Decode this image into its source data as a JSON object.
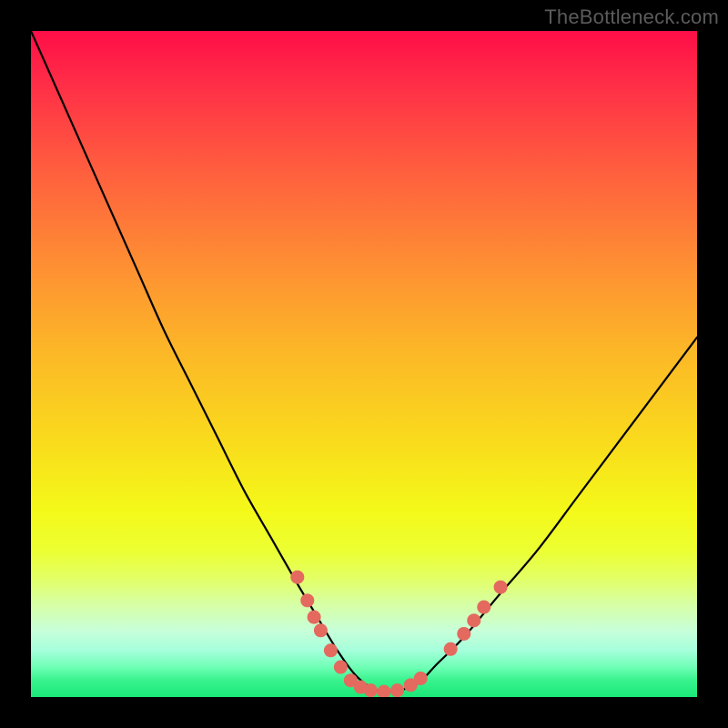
{
  "watermark": "TheBottleneck.com",
  "chart_data": {
    "type": "line",
    "title": "",
    "xlabel": "",
    "ylabel": "",
    "xlim": [
      0,
      100
    ],
    "ylim": [
      0,
      100
    ],
    "grid": false,
    "series": [
      {
        "name": "curve",
        "x": [
          0,
          4,
          8,
          12,
          16,
          20,
          24,
          28,
          32,
          36,
          40,
          43,
          46,
          49,
          52,
          55,
          58,
          61,
          65,
          70,
          76,
          82,
          88,
          94,
          100
        ],
        "y": [
          100,
          91,
          82,
          73,
          64,
          55,
          47,
          39,
          31,
          24,
          17,
          12,
          7,
          3,
          1,
          1,
          2,
          5,
          9,
          15,
          22,
          30,
          38,
          46,
          54
        ]
      }
    ],
    "markers": {
      "name": "highlight-dots",
      "color": "#e4695e",
      "points": [
        {
          "x": 40.0,
          "y": 18.0
        },
        {
          "x": 41.5,
          "y": 14.5
        },
        {
          "x": 42.5,
          "y": 12.0
        },
        {
          "x": 43.5,
          "y": 10.0
        },
        {
          "x": 45.0,
          "y": 7.0
        },
        {
          "x": 46.5,
          "y": 4.5
        },
        {
          "x": 48.0,
          "y": 2.5
        },
        {
          "x": 49.5,
          "y": 1.5
        },
        {
          "x": 51.0,
          "y": 1.0
        },
        {
          "x": 53.0,
          "y": 0.8
        },
        {
          "x": 55.0,
          "y": 1.0
        },
        {
          "x": 57.0,
          "y": 1.8
        },
        {
          "x": 58.5,
          "y": 2.8
        },
        {
          "x": 63.0,
          "y": 7.2
        },
        {
          "x": 65.0,
          "y": 9.5
        },
        {
          "x": 66.5,
          "y": 11.5
        },
        {
          "x": 68.0,
          "y": 13.5
        },
        {
          "x": 70.5,
          "y": 16.5
        }
      ]
    },
    "background_gradient": {
      "stops": [
        {
          "pos": 0.0,
          "color": "#FF0E47"
        },
        {
          "pos": 0.2,
          "color": "#FF5B3F"
        },
        {
          "pos": 0.48,
          "color": "#FCB727"
        },
        {
          "pos": 0.72,
          "color": "#F4F919"
        },
        {
          "pos": 0.9,
          "color": "#C8FFD9"
        },
        {
          "pos": 1.0,
          "color": "#1AE878"
        }
      ]
    }
  }
}
